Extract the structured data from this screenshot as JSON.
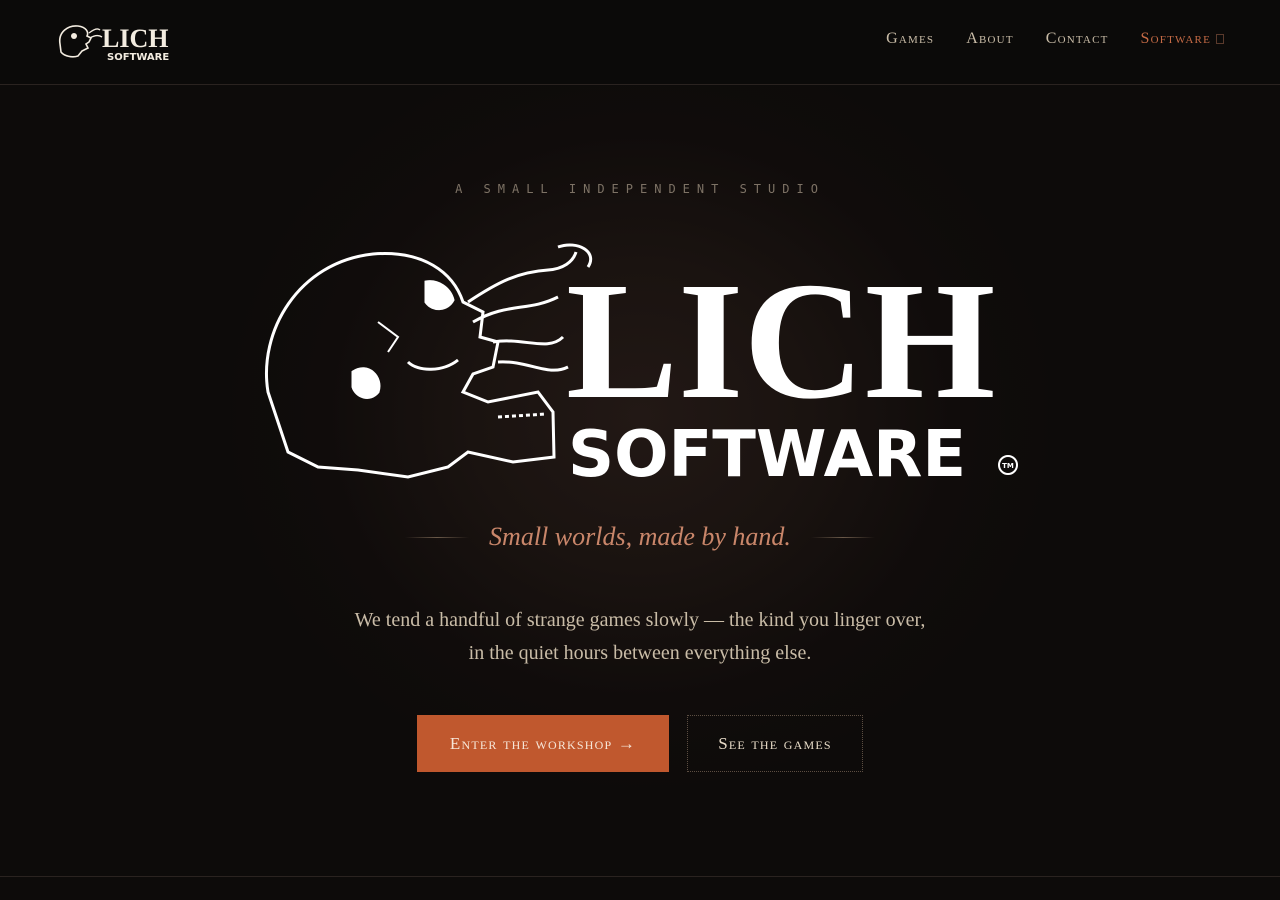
{
  "header": {
    "brand_line1": "LICH",
    "brand_line2": "SOFTWARE",
    "nav": [
      {
        "label": "Games"
      },
      {
        "label": "About"
      },
      {
        "label": "Contact"
      },
      {
        "label": "Software"
      }
    ],
    "active_nav": "Software"
  },
  "hero": {
    "eyebrow": "A SMALL INDEPENDENT STUDIO",
    "logo_line1": "LICH",
    "logo_line2": "SOFTWARE",
    "logo_mark": "TM",
    "tagline": "Small worlds, made by hand.",
    "intro_line1": "We tend a handful of strange games slowly — the kind you linger over,",
    "intro_line2": "in the quiet hours between everything else.",
    "primary_cta": "Enter the workshop →",
    "secondary_cta": "See the games"
  },
  "colors": {
    "background": "#0d0b0a",
    "accent": "#c0582e",
    "active_nav": "#c46a45",
    "tagline": "#c9866a"
  },
  "icons": {
    "logo_mark": "skull-icon",
    "nav_caret": "caret-icon"
  }
}
